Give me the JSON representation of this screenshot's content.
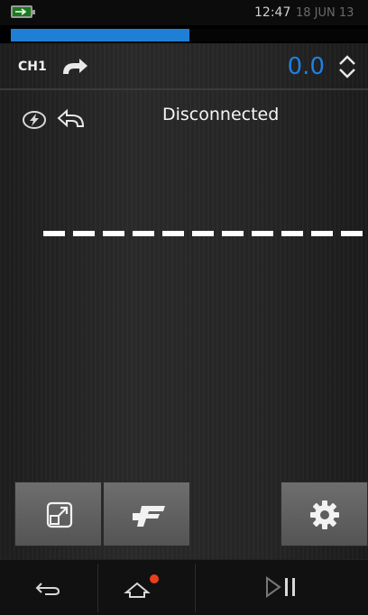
{
  "status_bar": {
    "time": "12:47",
    "date": "18 JUN 13",
    "battery_icon": "battery-charging-icon"
  },
  "progress": {
    "fraction": 0.5
  },
  "channel": {
    "label": "CH1",
    "direction_icon": "output-arrow-icon",
    "reading": "0.0",
    "adjust_icon": "up-down-chevron-icon"
  },
  "connection": {
    "status_text": "Disconnected",
    "icons": [
      "lightning-icon",
      "input-arrow-icon"
    ]
  },
  "buttons": [
    {
      "name": "expand-button",
      "icon": "expand-icon"
    },
    {
      "name": "function-button",
      "icon": "function-icon"
    },
    {
      "name": "settings-button",
      "icon": "gear-icon"
    }
  ],
  "navigation": {
    "back_icon": "back-icon",
    "home_icon": "home-icon",
    "play_pause_icon": "play-pause-icon"
  },
  "colors": {
    "accent": "#1f7fd6",
    "notification_dot": "#e8401c"
  }
}
